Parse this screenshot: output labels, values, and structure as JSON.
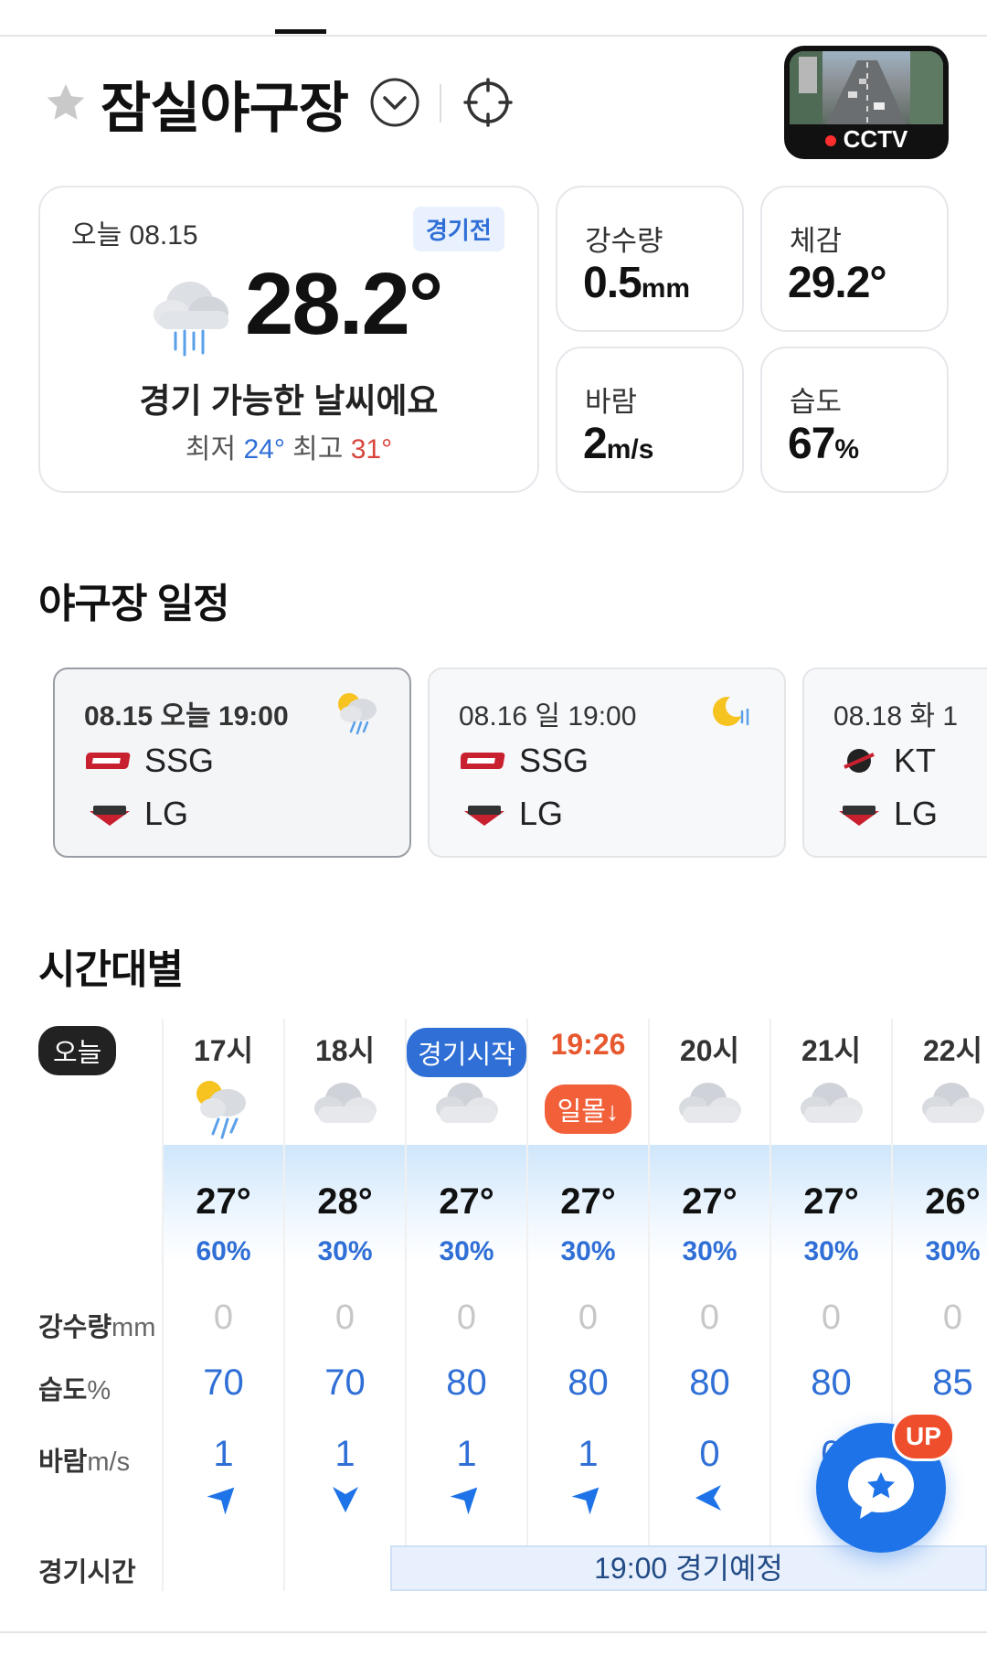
{
  "header": {
    "title": "잠실야구장",
    "cctv_label": "CCTV"
  },
  "current": {
    "date_label": "오늘 08.15",
    "status_badge": "경기전",
    "temperature": "28.2°",
    "summary": "경기 가능한 날씨에요",
    "min_label": "최저",
    "min_value": "24°",
    "max_label": "최고",
    "max_value": "31°",
    "icon": "rain-cloud-icon"
  },
  "stats": {
    "precip": {
      "label": "강수량",
      "value": "0.5",
      "unit": "mm"
    },
    "feels": {
      "label": "체감",
      "value": "29.2°"
    },
    "wind": {
      "label": "바람",
      "value": "2",
      "unit": "m/s"
    },
    "humidity": {
      "label": "습도",
      "value": "67",
      "unit": "%"
    }
  },
  "schedule": {
    "title": "야구장 일정",
    "games": [
      {
        "date": "08.15 오늘 19:00",
        "home": "SSG",
        "away": "LG",
        "icon": "sun-rain-icon"
      },
      {
        "date": "08.16 일 19:00",
        "home": "SSG",
        "away": "LG",
        "icon": "moon-rain-icon"
      },
      {
        "date": "08.18 화 1",
        "home": "KT",
        "away": "LG"
      }
    ]
  },
  "hourly": {
    "title": "시간대별",
    "today_label": "오늘",
    "columns": [
      {
        "time": "17시",
        "temp": "27°",
        "pop": "60%",
        "rain": "0",
        "humidity": "70",
        "wind": "1",
        "icon": "sun-rain-icon"
      },
      {
        "time": "18시",
        "temp": "28°",
        "pop": "30%",
        "rain": "0",
        "humidity": "70",
        "wind": "1",
        "icon": "cloud-icon"
      },
      {
        "time": "경기시작",
        "temp": "27°",
        "pop": "30%",
        "rain": "0",
        "humidity": "80",
        "wind": "1",
        "icon": "cloud-icon"
      },
      {
        "time": "19:26",
        "sunset": "일몰↓",
        "temp": "27°",
        "pop": "30%",
        "rain": "0",
        "humidity": "80",
        "wind": "1",
        "icon": "cloud-icon"
      },
      {
        "time": "20시",
        "temp": "27°",
        "pop": "30%",
        "rain": "0",
        "humidity": "80",
        "wind": "0",
        "icon": "cloud-icon"
      },
      {
        "time": "21시",
        "temp": "27°",
        "pop": "30%",
        "rain": "0",
        "humidity": "80",
        "wind": "0",
        "icon": "cloud-icon"
      },
      {
        "time": "22시",
        "temp": "26°",
        "pop": "30%",
        "rain": "0",
        "humidity": "85",
        "wind": "",
        "icon": "cloud-icon"
      }
    ],
    "labels": {
      "rain": "강수량",
      "rain_unit": "mm",
      "humidity": "습도",
      "humidity_unit": "%",
      "wind": "바람",
      "wind_unit": "m/s",
      "game_time": "경기시간"
    },
    "game_bar": "19:00 경기예정"
  },
  "fab": {
    "badge": "UP"
  }
}
